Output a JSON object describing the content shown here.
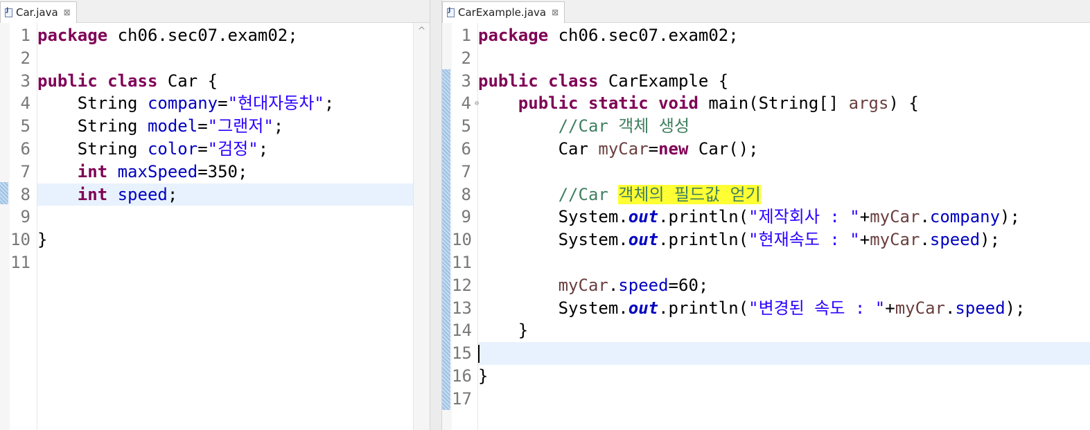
{
  "left_editor": {
    "tab": {
      "title": "Car.java",
      "close": "⊠"
    },
    "scroll_up": "^",
    "line_numbers": [
      "1",
      "2",
      "3",
      "4",
      "5",
      "6",
      "7",
      "8",
      "9",
      "10",
      "11"
    ],
    "code": {
      "l1": {
        "kw": "package",
        "rest": " ch06.sec07.exam02;"
      },
      "l3": {
        "kw1": "public",
        "kw2": "class",
        "rest": " Car {"
      },
      "l4": {
        "type": "String",
        "field": "company",
        "eq": "=",
        "str": "\"현대자동차\"",
        "end": ";"
      },
      "l5": {
        "type": "String",
        "field": "model",
        "eq": "=",
        "str": "\"그랜저\"",
        "end": ";"
      },
      "l6": {
        "type": "String",
        "field": "color",
        "eq": "=",
        "str": "\"검정\"",
        "end": ";"
      },
      "l7": {
        "kw": "int",
        "field": "maxSpeed",
        "rest": "=350;"
      },
      "l8": {
        "kw": "int",
        "field": "speed",
        "rest": ";"
      },
      "l10": {
        "rest": "}"
      }
    }
  },
  "right_editor": {
    "tab": {
      "title": "CarExample.java",
      "close": "⊠"
    },
    "fold_marker": "⊖",
    "line_numbers": [
      "1",
      "2",
      "3",
      "4",
      "5",
      "6",
      "7",
      "8",
      "9",
      "10",
      "11",
      "12",
      "13",
      "14",
      "15",
      "16",
      "17"
    ],
    "code": {
      "l1": {
        "kw": "package",
        "rest": " ch06.sec07.exam02;"
      },
      "l3": {
        "kw1": "public",
        "kw2": "class",
        "rest": " CarExample {"
      },
      "l4": {
        "kw1": "public",
        "kw2": "static",
        "kw3": "void",
        "mid": " main(String[] ",
        "param": "args",
        "end": ") {"
      },
      "l5": {
        "comment": "//Car 객체 생성"
      },
      "l6": {
        "a": "Car ",
        "var": "myCar",
        "b": "=",
        "kw": "new",
        "c": " Car();"
      },
      "l8": {
        "comment": "//Car ",
        "highlight": "객체의 필드값 얻기"
      },
      "l9": {
        "a": "System.",
        "st": "out",
        "b": ".println(",
        "str": "\"제작회사 : \"",
        "c": "+",
        "var": "myCar",
        "d": ".",
        "field": "company",
        "e": ");"
      },
      "l10": {
        "a": "System.",
        "st": "out",
        "b": ".println(",
        "str": "\"현재속도 : \"",
        "c": "+",
        "var": "myCar",
        "d": ".",
        "field": "speed",
        "e": ");"
      },
      "l12": {
        "var": "myCar",
        "d": ".",
        "field": "speed",
        "rest": "=60;"
      },
      "l13": {
        "a": "System.",
        "st": "out",
        "b": ".println(",
        "str": "\"변경된 속도 : \"",
        "c": "+",
        "var": "myCar",
        "d": ".",
        "field": "speed",
        "e": ");"
      },
      "l14": {
        "rest": "}"
      },
      "l16": {
        "rest": "}"
      }
    }
  }
}
